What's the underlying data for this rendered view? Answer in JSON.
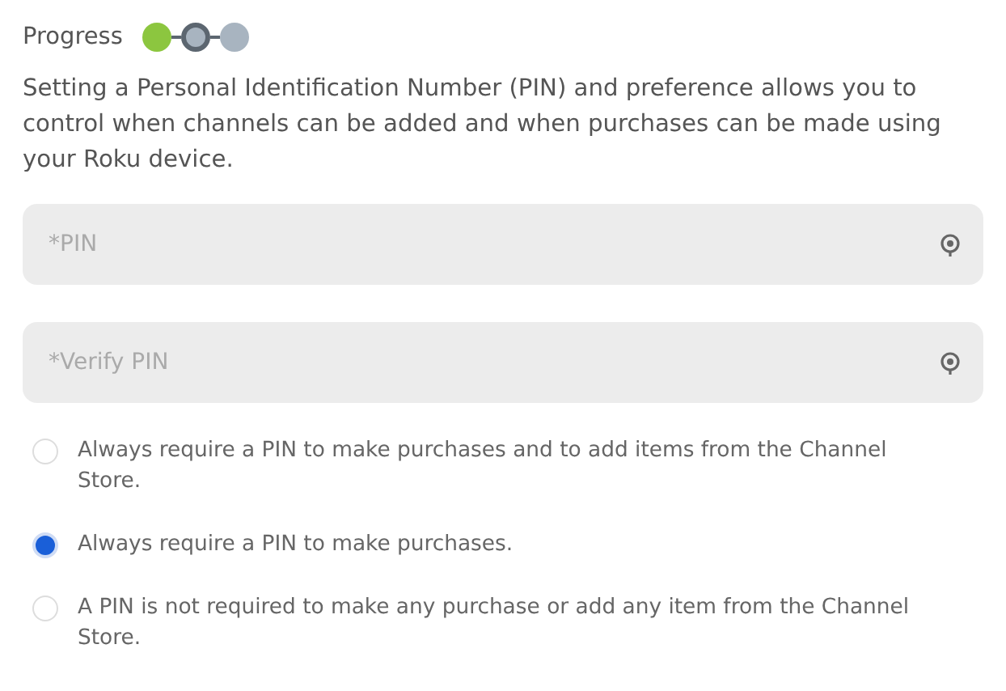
{
  "progress": {
    "label": "Progress",
    "steps": [
      {
        "completed": true,
        "selected": false
      },
      {
        "completed": false,
        "selected": true
      },
      {
        "completed": false,
        "selected": false
      }
    ]
  },
  "description": "Setting a Personal Identification Number (PIN) and preference allows you to control when channels can be added and when purchases can be made using your Roku device.",
  "fields": [
    {
      "placeholder": "*PIN"
    },
    {
      "placeholder": "*Verify PIN"
    }
  ],
  "options": [
    {
      "label": "Always require a PIN to make purchases and to add items from the Channel Store.",
      "selected": false
    },
    {
      "label": "Always require a PIN to make purchases.",
      "selected": true
    },
    {
      "label": "A PIN is not required to make any purchase or add any item from the Channel Store.",
      "selected": false
    }
  ]
}
